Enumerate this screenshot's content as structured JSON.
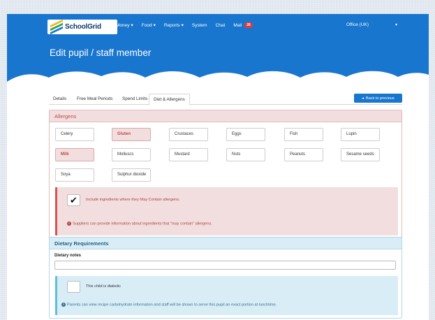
{
  "nav": {
    "brand": "SchoolGrid",
    "links": [
      {
        "label": "Money",
        "caret": "▾"
      },
      {
        "label": "Food",
        "caret": "▾"
      },
      {
        "label": "Reports",
        "caret": "▾"
      },
      {
        "label": "System",
        "caret": ""
      },
      {
        "label": "Chat",
        "caret": ""
      },
      {
        "label": "Mail",
        "caret": ""
      }
    ],
    "mail_count": "26",
    "office": "Office (UK)",
    "office_caret": "▾"
  },
  "page": {
    "title": "Edit pupil / staff member"
  },
  "tabs": [
    {
      "label": "Details"
    },
    {
      "label": "Free Meal Periods"
    },
    {
      "label": "Spend Limits"
    },
    {
      "label": "Diet & Allergens"
    }
  ],
  "back_button": {
    "label": "Back to previous",
    "icon": "◂"
  },
  "allergens": {
    "title": "Allergens",
    "items": [
      {
        "label": "Celery"
      },
      {
        "label": "Gluten"
      },
      {
        "label": "Crustaces"
      },
      {
        "label": "Eggs"
      },
      {
        "label": "Fish"
      },
      {
        "label": "Lupin"
      },
      {
        "label": "Milk"
      },
      {
        "label": "Molluscs"
      },
      {
        "label": "Mustard"
      },
      {
        "label": "Nuts"
      },
      {
        "label": "Peanuts"
      },
      {
        "label": "Sesame seeds"
      },
      {
        "label": "Soya"
      },
      {
        "label": "Sulphur dioxide"
      }
    ],
    "may_contain_label": "Include ingredients where they May Contain allergens.",
    "may_contain_check": "✔",
    "info_icon": "!",
    "info_text": "Suppliers can provide information about ingredients that \"may contain\" allergens."
  },
  "diet": {
    "title": "Dietary Requirements",
    "notes_label": "Dietary notes",
    "notes_value": "",
    "diabetic_label": "This child is diabetic",
    "info_icon": "i",
    "info_text": "Parents can view recipe carbohydrate information and staff will be shown to serve this pupil an exact portion at lunchtime."
  },
  "colors": {
    "brand_blue": "#1976cf",
    "danger_bg": "#f2dede",
    "danger_text": "#a94442",
    "info_bg": "#d9edf7",
    "info_text": "#31708f",
    "badge": "#e53935"
  }
}
